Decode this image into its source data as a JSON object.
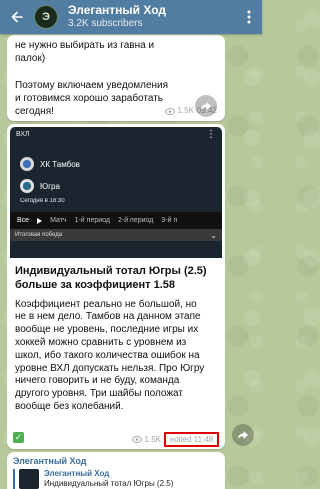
{
  "header": {
    "title": "Элегантный Ход",
    "subtitle": "3.2K subscribers",
    "avatar_letter": "Э"
  },
  "top_message": {
    "text": "не нужно выбирать из гавна и\nпалок)\n\nПоэтому включаем уведомления\nи готовимся хорошо заработать\nсегодня!",
    "views": "1.5K",
    "time": "09:42"
  },
  "main_post": {
    "media": {
      "league": "ВХЛ",
      "team1": "ХК Тамбов",
      "team2": "Югра",
      "when": "Сегодня в 18:30",
      "tabs": [
        "Все",
        "Матч",
        "1-й период",
        "2-й период",
        "3-й п"
      ],
      "market": "Итоговая победа"
    },
    "title": "Индивидуальный тотал Югры (2.5)\nбольше за коэффициент 1.58",
    "body": "Коэффициент реально не большой, но\nне в нем дело. Тамбов на данном этапе\nвообще не уровень, последние игры их\nхоккей можно сравнить с уровнем из\nшкол, ибо такого количества ошибок на\nуровне ВХЛ допускать нельзя. Про Югру\nничего говорить и не буду, команда\nдругого уровня. Три шайбы положат\nвообще без колебаний.",
    "views": "1.5K",
    "edited": "edited 11:48"
  },
  "forward_preview": {
    "channel": "Элегантный Ход",
    "source": "Элегантный Ход",
    "snippet": "Индивидуальный тотал Югры (2.5)"
  },
  "colors": {
    "header_bg": "#517da2",
    "highlight": "#e00000",
    "check": "#4caf50"
  }
}
